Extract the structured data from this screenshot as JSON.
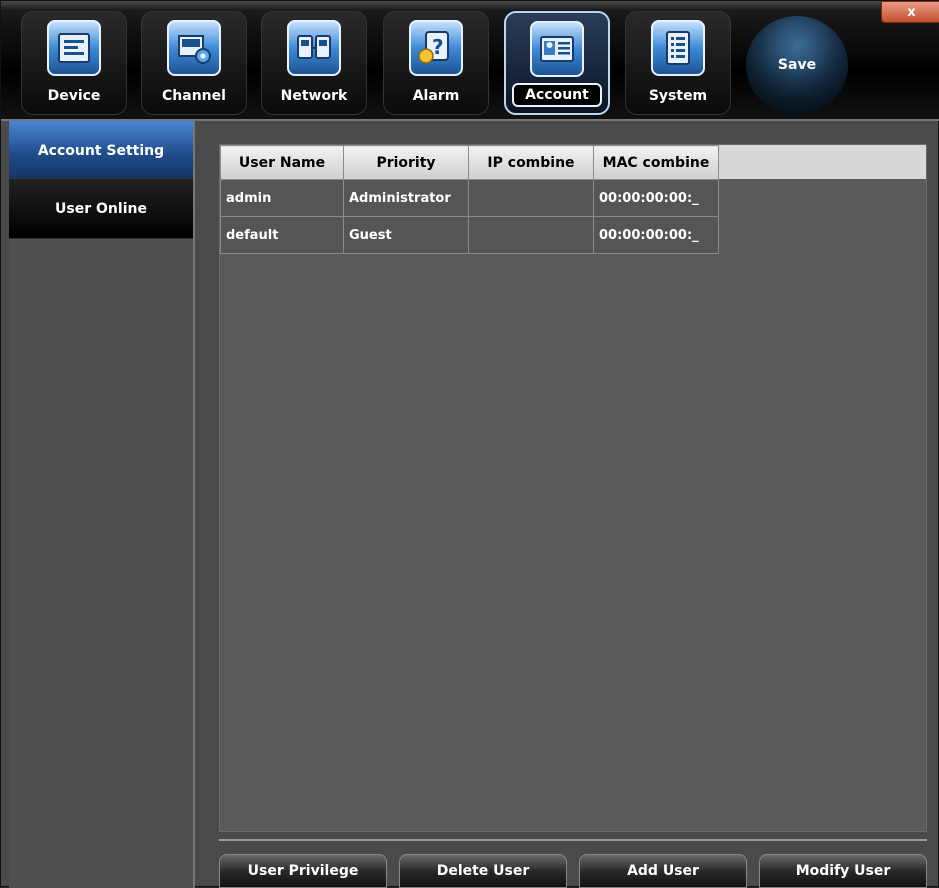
{
  "window": {
    "close_label": "x"
  },
  "toolbar": {
    "tabs": [
      {
        "label": "Device",
        "icon": "device-icon"
      },
      {
        "label": "Channel",
        "icon": "channel-icon"
      },
      {
        "label": "Network",
        "icon": "network-icon"
      },
      {
        "label": "Alarm",
        "icon": "alarm-icon"
      },
      {
        "label": "Account",
        "icon": "account-icon",
        "active": true
      },
      {
        "label": "System",
        "icon": "system-icon"
      }
    ],
    "save_label": "Save"
  },
  "sidebar": {
    "items": [
      {
        "label": "Account Setting",
        "active": true
      },
      {
        "label": "User Online",
        "active": false
      }
    ]
  },
  "table": {
    "columns": [
      "User Name",
      "Priority",
      "IP combine",
      "MAC combine"
    ],
    "rows": [
      {
        "user_name": "admin",
        "priority": "Administrator",
        "ip_combine": "",
        "mac_combine": "00:00:00:00:_"
      },
      {
        "user_name": "default",
        "priority": "Guest",
        "ip_combine": "",
        "mac_combine": "00:00:00:00:_"
      }
    ]
  },
  "actions": {
    "user_privilege": "User Privilege",
    "delete_user": "Delete User",
    "add_user": "Add User",
    "modify_user": "Modify User"
  },
  "colors": {
    "accent": "#2f6bb8",
    "panel": "#5a5a5a",
    "close": "#d0623c"
  }
}
